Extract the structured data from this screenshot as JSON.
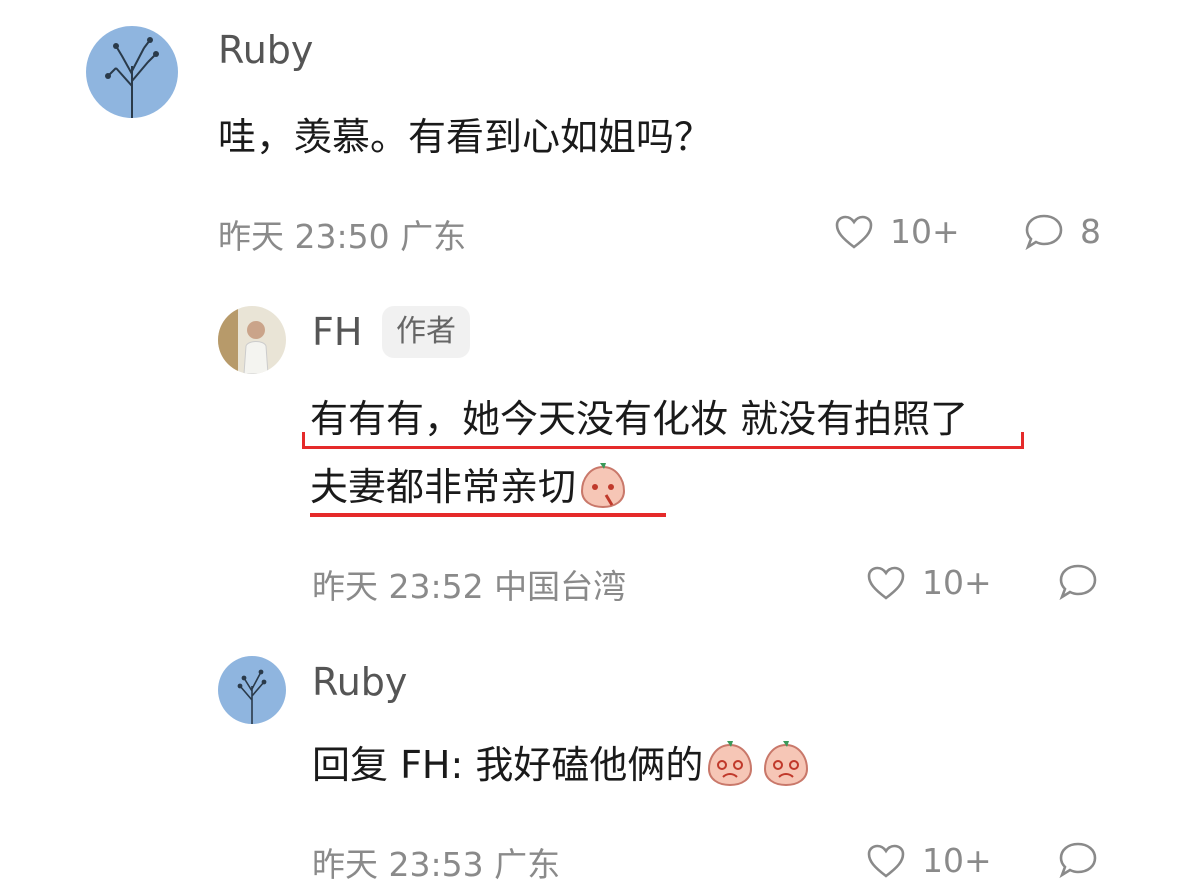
{
  "comments": [
    {
      "author": "Ruby",
      "text": "哇，羡慕。有看到心如姐吗？",
      "time": "昨天 23:50",
      "location": "广东",
      "likes": "10+",
      "replies": "8"
    },
    {
      "author": "FH",
      "author_badge": "作者",
      "text_line1": "有有有，她今天没有化妆 就没有拍照了",
      "text_line2": "夫妻都非常亲切",
      "emoji": "peach-face-emoji",
      "time": "昨天 23:52",
      "location": "中国台湾",
      "likes": "10+",
      "highlight_color": "#e52a2a"
    },
    {
      "author": "Ruby",
      "reply_prefix": "回复 FH:",
      "text": "我好磕他俩的",
      "emoji": "peach-face-emoji",
      "time": "昨天 23:53",
      "location": "广东",
      "likes": "10+"
    }
  ],
  "icons": {
    "like": "heart-outline-icon",
    "reply": "speech-bubble-icon"
  }
}
